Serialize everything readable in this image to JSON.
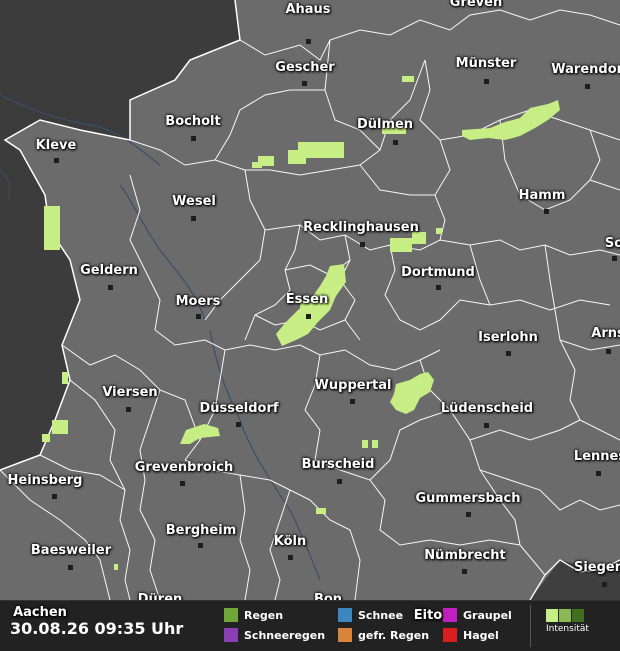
{
  "timestamp": "30.08.26 09:35 Uhr",
  "colors": {
    "land": "#6b6b6b",
    "outside": "#3c3c3c",
    "border": "#ffffff",
    "rain_light": "#c7ee84",
    "rain_mid": "#8ab854",
    "rain_dark": "#3f6f1f"
  },
  "cities": [
    {
      "name": "Ahaus"
    },
    {
      "name": "Greven"
    },
    {
      "name": "Gescher"
    },
    {
      "name": "Münster"
    },
    {
      "name": "Warendorf"
    },
    {
      "name": "Bocholt"
    },
    {
      "name": "Dülmen"
    },
    {
      "name": "Kleve"
    },
    {
      "name": "Hamm"
    },
    {
      "name": "Wesel"
    },
    {
      "name": "Recklinghausen"
    },
    {
      "name": "So"
    },
    {
      "name": "Geldern"
    },
    {
      "name": "Dortmund"
    },
    {
      "name": "Moers"
    },
    {
      "name": "Essen"
    },
    {
      "name": "Arns"
    },
    {
      "name": "Iserlohn"
    },
    {
      "name": "Viersen"
    },
    {
      "name": "Wuppertal"
    },
    {
      "name": "Düsseldorf"
    },
    {
      "name": "Lüdenscheid"
    },
    {
      "name": "Lennes"
    },
    {
      "name": "Grevenbroich"
    },
    {
      "name": "Burscheid"
    },
    {
      "name": "Heinsberg"
    },
    {
      "name": "Gummersbach"
    },
    {
      "name": "Bergheim"
    },
    {
      "name": "Köln"
    },
    {
      "name": "Baesweiler"
    },
    {
      "name": "Nümbrecht"
    },
    {
      "name": "Siegen"
    },
    {
      "name": "Aachen"
    },
    {
      "name": "Düren"
    },
    {
      "name": "Bon"
    },
    {
      "name": "Eito"
    }
  ],
  "legend": {
    "items": [
      {
        "label": "Regen",
        "color": "#6ea63a"
      },
      {
        "label": "Schneeregen",
        "color": "#8a3fb5"
      },
      {
        "label": "Schnee",
        "color": "#3d86c0"
      },
      {
        "label": "gefr. Regen",
        "color": "#d8843a"
      },
      {
        "label": "Graupel",
        "color": "#c21fc2"
      },
      {
        "label": "Hagel",
        "color": "#d81e1e"
      }
    ],
    "intensity_label": "Intensität",
    "intensity_colors": [
      "#c7ee84",
      "#8ab854",
      "#3f6f1f"
    ]
  }
}
